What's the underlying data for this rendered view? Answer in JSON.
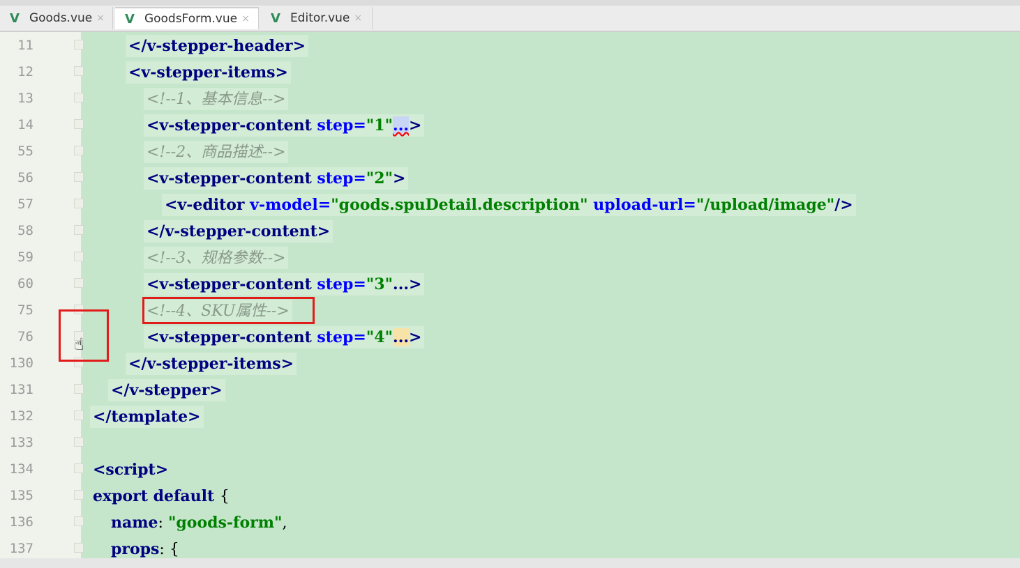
{
  "tabs": [
    {
      "label": "Goods.vue",
      "icon": "vue-icon",
      "active": false
    },
    {
      "label": "GoodsForm.vue",
      "icon": "vue-icon",
      "active": true
    },
    {
      "label": "Editor.vue",
      "icon": "vue-icon",
      "active": false
    }
  ],
  "tab_close_glyph": "×",
  "tab_icon_glyph": "V",
  "lines": [
    {
      "num": "11",
      "parts": [
        [
          "tag",
          "</v-stepper-header>"
        ]
      ]
    },
    {
      "num": "12",
      "parts": [
        [
          "tag",
          "<v-stepper-items>"
        ]
      ]
    },
    {
      "num": "13",
      "parts": [
        [
          "cmt",
          "<!--1、基本信息-->"
        ]
      ]
    },
    {
      "num": "14",
      "parts": [
        [
          "tag",
          "<v-stepper-content "
        ],
        [
          "attr",
          "step="
        ],
        [
          "val",
          "\"1\""
        ],
        [
          "fold-dots-blue",
          "..."
        ],
        [
          "tag",
          ">"
        ]
      ]
    },
    {
      "num": "55",
      "parts": [
        [
          "cmt",
          "<!--2、商品描述-->"
        ]
      ]
    },
    {
      "num": "56",
      "parts": [
        [
          "tag",
          "<v-stepper-content "
        ],
        [
          "attr",
          "step="
        ],
        [
          "val",
          "\"2\""
        ],
        [
          "tag",
          ">"
        ]
      ]
    },
    {
      "num": "57",
      "parts": [
        [
          "tag",
          "<v-editor "
        ],
        [
          "attr",
          "v-model="
        ],
        [
          "val",
          "\"goods.spuDetail.description\""
        ],
        [
          "attr",
          " upload-url="
        ],
        [
          "val",
          "\"/upload/image\""
        ],
        [
          "tag",
          "/>"
        ]
      ]
    },
    {
      "num": "58",
      "parts": [
        [
          "tag",
          "</v-stepper-content>"
        ]
      ]
    },
    {
      "num": "59",
      "parts": [
        [
          "cmt",
          "<!--3、规格参数-->"
        ]
      ]
    },
    {
      "num": "60",
      "parts": [
        [
          "tag",
          "<v-stepper-content "
        ],
        [
          "attr",
          "step="
        ],
        [
          "val",
          "\"3\""
        ],
        [
          "tag",
          "...>"
        ]
      ]
    },
    {
      "num": "75",
      "parts": [
        [
          "cmt",
          "<!--4、SKU属性-->"
        ]
      ]
    },
    {
      "num": "76",
      "parts": [
        [
          "tag",
          "<v-stepper-content "
        ],
        [
          "attr",
          "step="
        ],
        [
          "val",
          "\"4\""
        ],
        [
          "fold-dots-orange",
          "..."
        ],
        [
          "tag",
          ">"
        ]
      ]
    },
    {
      "num": "130",
      "parts": [
        [
          "tag",
          "</v-stepper-items>"
        ]
      ]
    },
    {
      "num": "131",
      "parts": [
        [
          "tag",
          "</v-stepper>"
        ]
      ]
    },
    {
      "num": "132",
      "parts": [
        [
          "tag",
          "</template>"
        ]
      ]
    },
    {
      "num": "133",
      "parts": []
    },
    {
      "num": "134",
      "parts": [
        [
          "tag",
          "<script>"
        ]
      ]
    },
    {
      "num": "135",
      "parts": [
        [
          "kw",
          "export default "
        ],
        [
          "plain",
          "{"
        ]
      ]
    },
    {
      "num": "136",
      "parts": [
        [
          "kw",
          "name"
        ],
        [
          "plain",
          ": "
        ],
        [
          "val",
          "\"goods-form\""
        ],
        [
          "plain",
          ","
        ]
      ]
    },
    {
      "num": "137",
      "parts": [
        [
          "kw",
          "props"
        ],
        [
          "plain",
          ": {"
        ]
      ]
    }
  ],
  "colors": {
    "editor_bg": "#c5e6cb",
    "highlight_box": "#e21b1b",
    "tag": "#000080",
    "attribute": "#0000ff",
    "string": "#008000",
    "comment": "#8a9a8a"
  }
}
